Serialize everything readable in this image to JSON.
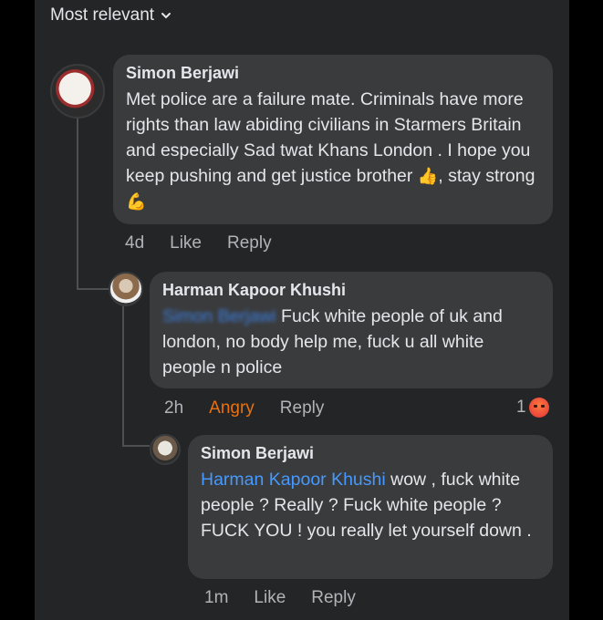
{
  "header": {
    "sort_label": "Most relevant"
  },
  "comments": [
    {
      "author": "Simon Berjawi",
      "text_part1": "Met police are a failure mate. Criminals have more rights than law abiding civilians in Starmers Britain and especially Sad twat Khans London . I hope you keep pushing and get justice brother",
      "emoji1": "👍",
      "text_part2": ", stay strong",
      "emoji2": "💪",
      "time": "4d",
      "like": "Like",
      "reply": "Reply"
    },
    {
      "author": "Harman Kapoor Khushi",
      "mention": "Simon Berjawi",
      "text": " Fuck white people of uk and london, no body help me, fuck u all white people n police",
      "time": "2h",
      "reaction_label": "Angry",
      "reply": "Reply",
      "reaction_count": "1"
    },
    {
      "author": "Simon Berjawi",
      "mention": "Harman Kapoor Khushi",
      "text": " wow , fuck white people ? Really ? Fuck white people ? FUCK YOU ! you really let yourself down .",
      "time": "1m",
      "like": "Like",
      "reply": "Reply"
    }
  ],
  "colors": {
    "background": "#242526",
    "bubble": "#3a3b3c",
    "mention": "#4599ff",
    "angry": "#e9710f",
    "muted": "#b0b3b8"
  }
}
